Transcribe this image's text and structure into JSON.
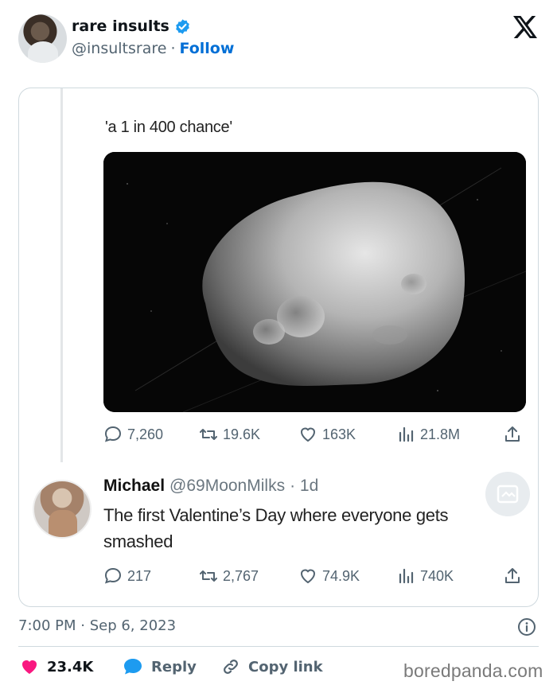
{
  "author": {
    "display_name": "rare insults",
    "handle": "@insultsrare",
    "separator": "·",
    "follow_label": "Follow"
  },
  "embedded": {
    "quote_text": "'a 1 in 400 chance'",
    "stats": {
      "replies": "7,260",
      "reposts": "19.6K",
      "likes": "163K",
      "views": "21.8M"
    },
    "reply": {
      "name": "Michael",
      "handle": "@69MoonMilks",
      "age": "· 1d",
      "text": "The first Valentine’s Day where everyone gets smashed",
      "stats": {
        "replies": "217",
        "reposts": "2,767",
        "likes": "74.9K",
        "views": "740K"
      }
    }
  },
  "timestamp": "7:00 PM · Sep 6, 2023",
  "footer": {
    "likes": "23.4K",
    "reply_label": "Reply",
    "copy_label": "Copy link"
  },
  "watermark": "boredpanda.com",
  "colors": {
    "verified": "#1d9bf0",
    "like_heart": "#f91880",
    "reply_bubble": "#1d9bf0",
    "follow": "#006fd6"
  }
}
